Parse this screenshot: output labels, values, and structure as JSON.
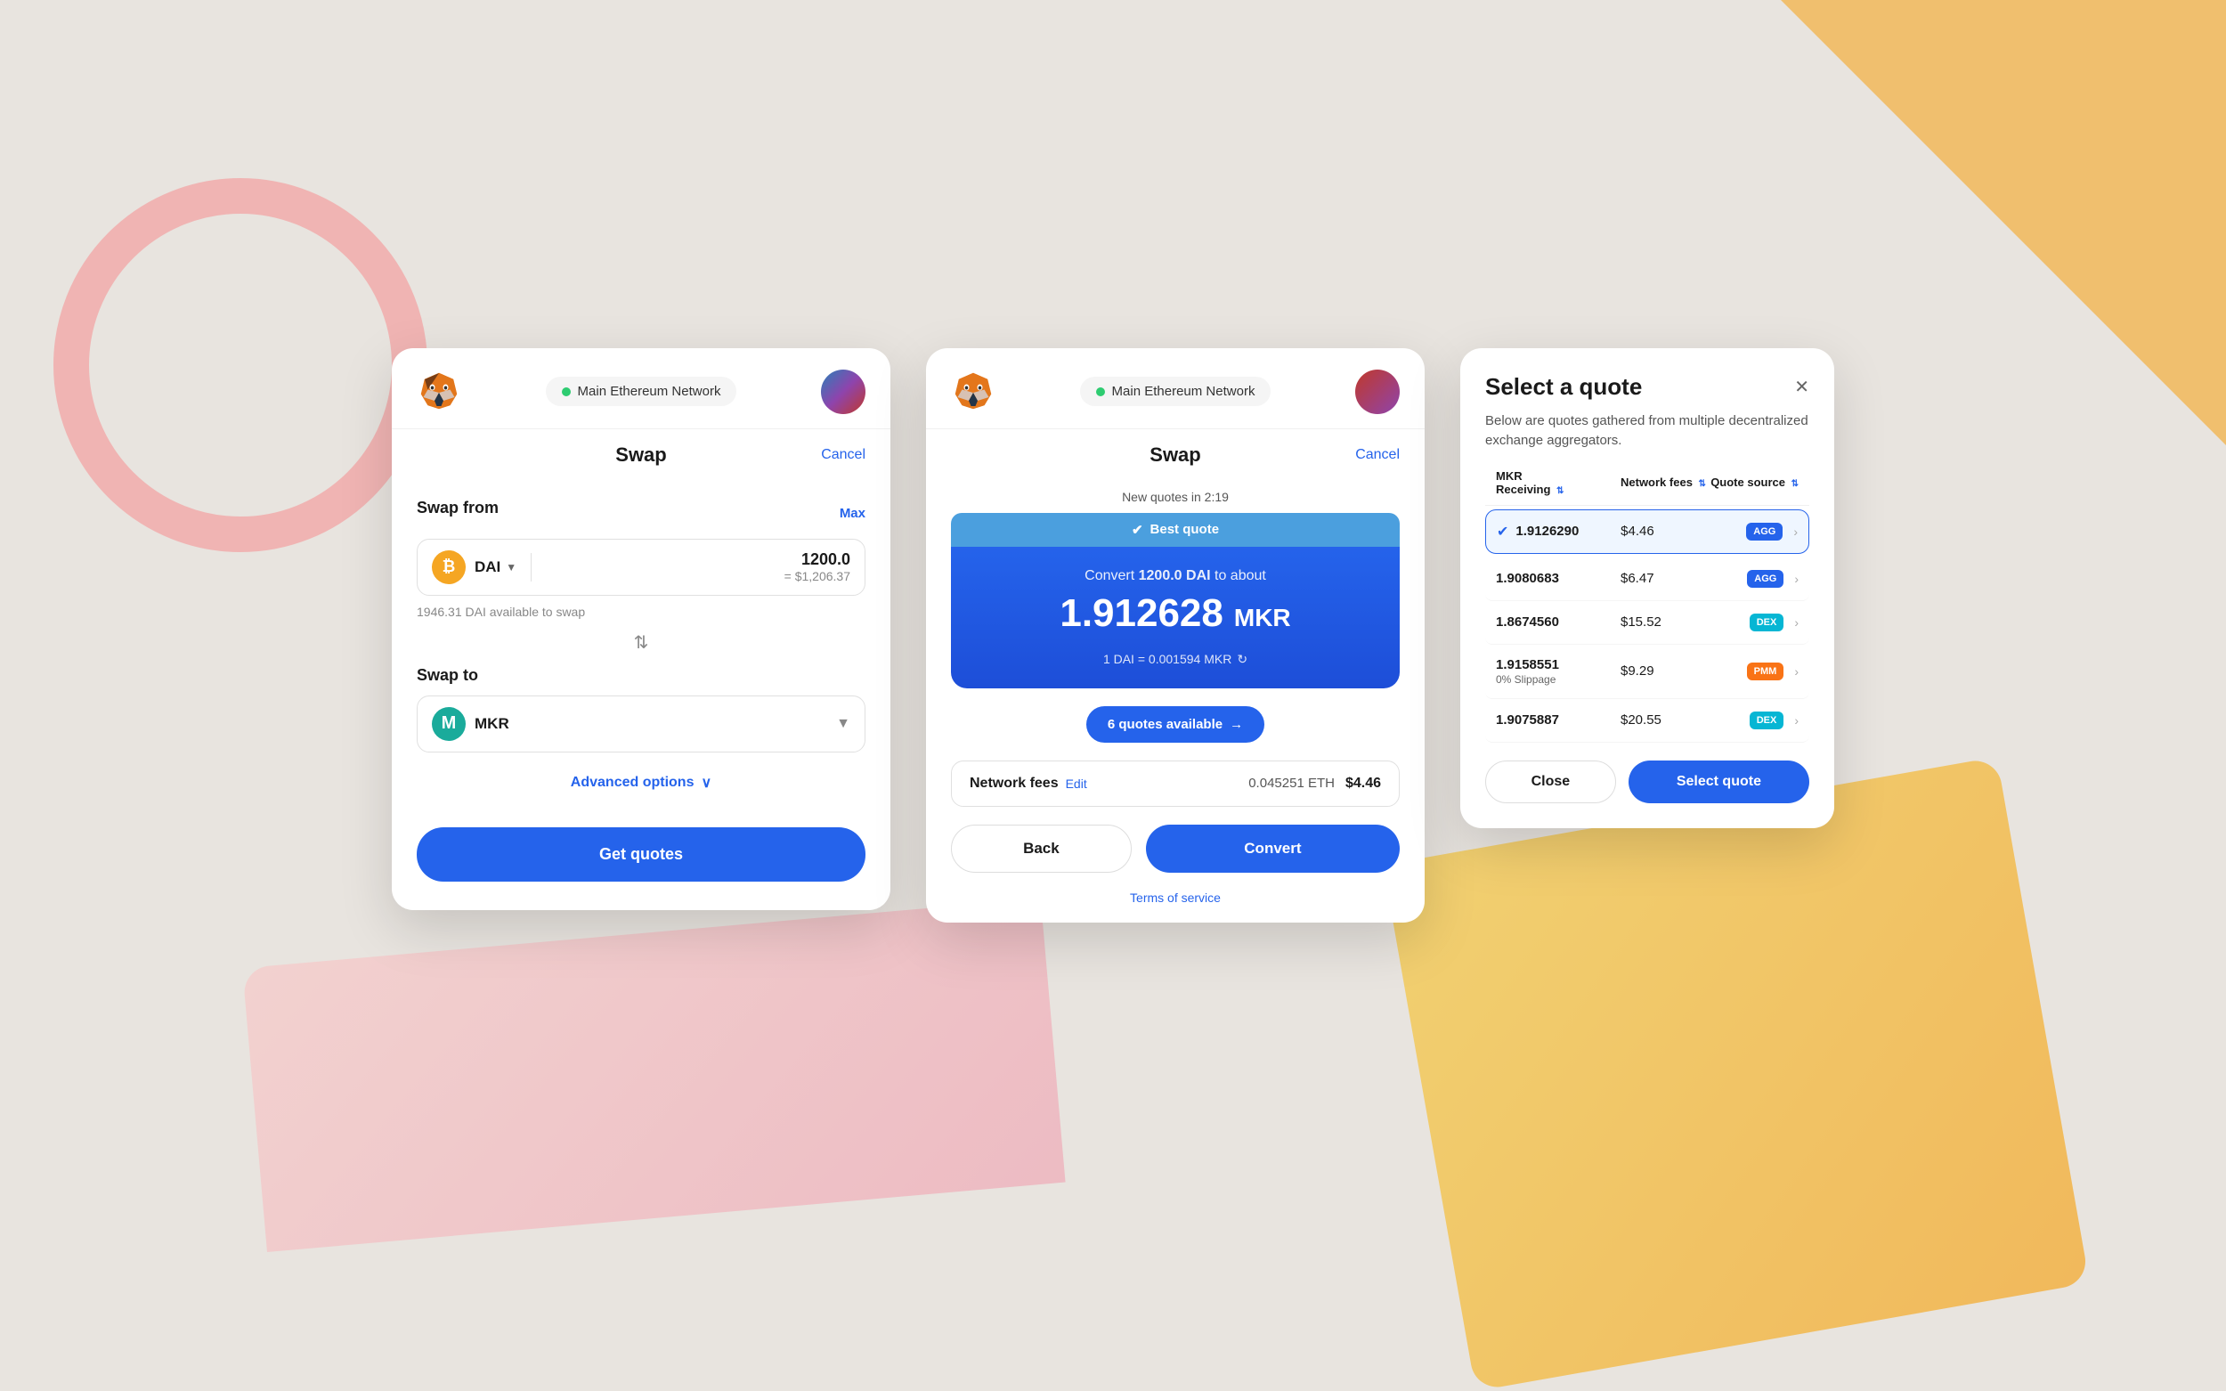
{
  "background": {
    "accent_pink": "#f4a0a0",
    "accent_orange": "#f5a623",
    "accent_gradient_pink": "#f9c5c5"
  },
  "panel1": {
    "network": "Main Ethereum Network",
    "title": "Swap",
    "cancel_label": "Cancel",
    "swap_from_label": "Swap from",
    "max_label": "Max",
    "token_from": "DAI",
    "amount": "1200.0",
    "usd_equiv": "= $1,206.37",
    "available": "1946.31 DAI available to swap",
    "swap_to_label": "Swap to",
    "token_to": "MKR",
    "advanced_options_label": "Advanced options",
    "get_quotes_label": "Get quotes"
  },
  "panel2": {
    "network": "Main Ethereum Network",
    "title": "Swap",
    "cancel_label": "Cancel",
    "new_quotes_label": "New quotes in 2:19",
    "best_quote_label": "Best quote",
    "convert_text": "Convert",
    "convert_amount": "1200.0",
    "convert_token": "DAI",
    "convert_connector": "to about",
    "mkr_amount": "1.912628",
    "mkr_label": "MKR",
    "exchange_rate": "1 DAI = 0.001594 MKR",
    "quotes_available": "6 quotes available",
    "network_fees_label": "Network fees",
    "edit_label": "Edit",
    "fees_eth": "0.045251 ETH",
    "fees_usd": "$4.46",
    "back_label": "Back",
    "convert_label": "Convert",
    "tos_label": "Terms of service"
  },
  "panel3": {
    "title": "Select a quote",
    "subtitle": "Below are quotes gathered from multiple decentralized exchange aggregators.",
    "col_mkr_label": "MKR",
    "col_receiving_label": "Receiving",
    "col_fees_label": "Network fees",
    "col_source_label": "Quote source",
    "quotes": [
      {
        "id": 1,
        "receiving": "1.9126290",
        "sub_label": "",
        "fees": "$4.46",
        "source": "AGG",
        "badge_class": "badge-agg",
        "selected": true
      },
      {
        "id": 2,
        "receiving": "1.9080683",
        "sub_label": "",
        "fees": "$6.47",
        "source": "AGG",
        "badge_class": "badge-agg",
        "selected": false
      },
      {
        "id": 3,
        "receiving": "1.8674560",
        "sub_label": "",
        "fees": "$15.52",
        "source": "DEX",
        "badge_class": "badge-dex",
        "selected": false
      },
      {
        "id": 4,
        "receiving": "1.9158551",
        "sub_label": "0% Slippage",
        "fees": "$9.29",
        "source": "PMM",
        "badge_class": "badge-pmm",
        "selected": false
      },
      {
        "id": 5,
        "receiving": "1.9075887",
        "sub_label": "",
        "fees": "$20.55",
        "source": "DEX",
        "badge_class": "badge-dex",
        "selected": false
      }
    ],
    "close_label": "Close",
    "select_quote_label": "Select quote"
  }
}
